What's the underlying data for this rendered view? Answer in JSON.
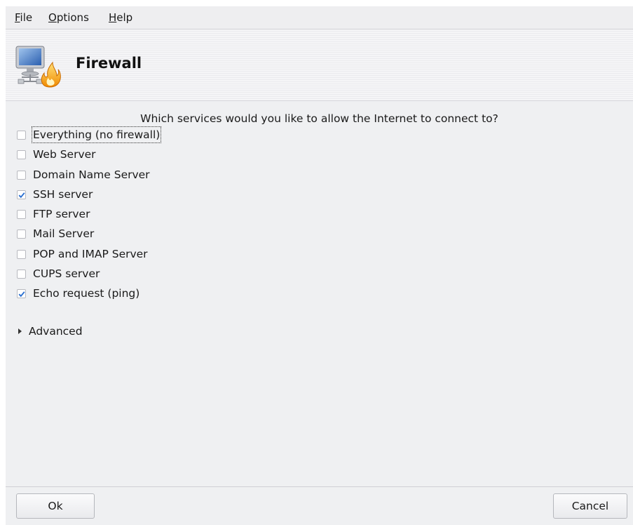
{
  "menu": {
    "items": [
      {
        "mnemonic": "F",
        "rest": "ile"
      },
      {
        "mnemonic": "O",
        "rest": "ptions"
      },
      {
        "mnemonic": "H",
        "rest": "elp"
      }
    ]
  },
  "banner": {
    "title": "Firewall",
    "icon": "firewall-computer-flame-icon"
  },
  "main": {
    "question": "Which services would you like to allow the Internet to connect to?",
    "services": [
      {
        "label": "Everything (no firewall)",
        "checked": false,
        "focused": true
      },
      {
        "label": "Web Server",
        "checked": false
      },
      {
        "label": "Domain Name Server",
        "checked": false
      },
      {
        "label": "SSH server",
        "checked": true
      },
      {
        "label": "FTP server",
        "checked": false
      },
      {
        "label": "Mail Server",
        "checked": false
      },
      {
        "label": "POP and IMAP Server",
        "checked": false
      },
      {
        "label": "CUPS server",
        "checked": false
      },
      {
        "label": "Echo request (ping)",
        "checked": true
      }
    ],
    "advanced_label": "Advanced"
  },
  "buttons": {
    "ok_label": "Ok",
    "cancel_label": "Cancel"
  },
  "colors": {
    "check_color": "#2a6fd0",
    "window_bg": "#eff0f2"
  }
}
